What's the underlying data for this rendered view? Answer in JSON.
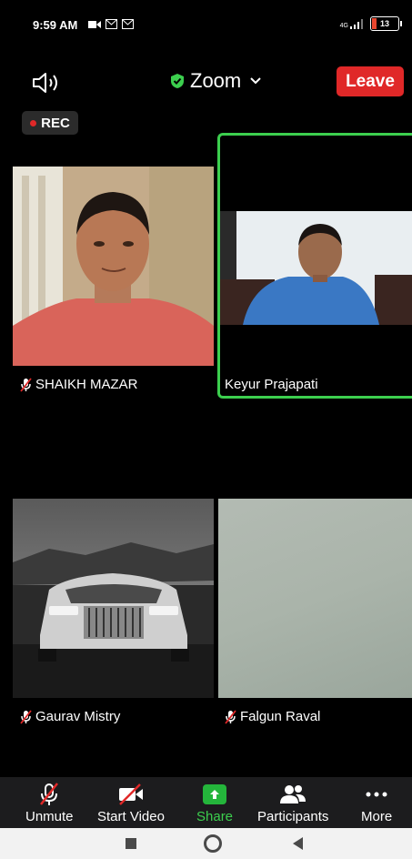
{
  "status_bar": {
    "time": "9:59 AM",
    "network": "4G",
    "battery": "13"
  },
  "meeting": {
    "title": "Zoom",
    "leave_label": "Leave",
    "rec_label": "REC"
  },
  "participants": [
    {
      "name": "SHAIKH MAZAR",
      "muted": true,
      "active_speaker": false
    },
    {
      "name": "Keyur Prajapati",
      "muted": false,
      "active_speaker": true
    },
    {
      "name": "Gaurav Mistry",
      "muted": true,
      "active_speaker": false
    },
    {
      "name": "Falgun Raval",
      "muted": true,
      "active_speaker": false
    }
  ],
  "toolbar": {
    "unmute_label": "Unmute",
    "start_video_label": "Start Video",
    "share_label": "Share",
    "participants_label": "Participants",
    "more_label": "More"
  },
  "colors": {
    "accent_green": "#3ccf4e",
    "leave_red": "#e02828",
    "active_border": "#3ccf4e"
  },
  "icons": [
    "speaker-icon",
    "shield-check-icon",
    "chevron-down-icon",
    "mic-muted-icon",
    "video-off-icon",
    "share-up-arrow-icon",
    "participants-icon",
    "more-dots-icon"
  ]
}
